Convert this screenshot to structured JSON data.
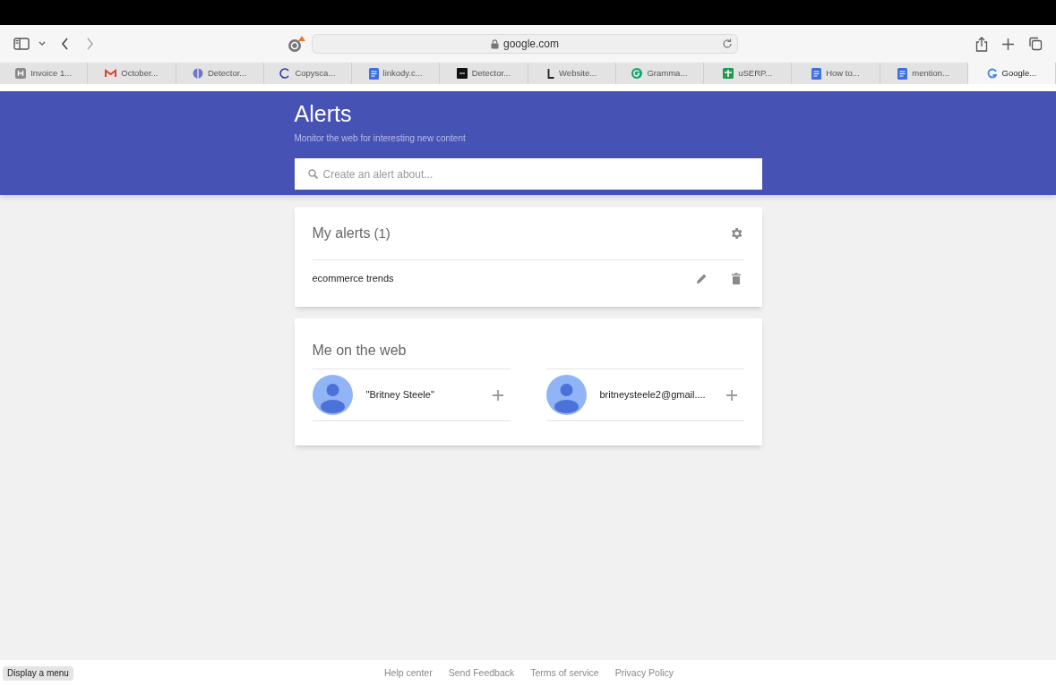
{
  "browser": {
    "address": "google.com",
    "tabs": [
      {
        "label": "Invoice 1...",
        "selected": false
      },
      {
        "label": "October...",
        "selected": false
      },
      {
        "label": "Detector...",
        "selected": false
      },
      {
        "label": "Copysca...",
        "selected": false
      },
      {
        "label": "linkody.c...",
        "selected": false
      },
      {
        "label": "Detector...",
        "selected": false
      },
      {
        "label": "Website...",
        "selected": false
      },
      {
        "label": "Gramma...",
        "selected": false
      },
      {
        "label": "uSERP...",
        "selected": false
      },
      {
        "label": "How to...",
        "selected": false
      },
      {
        "label": "mention...",
        "selected": false
      },
      {
        "label": "Google...",
        "selected": true
      }
    ]
  },
  "header": {
    "title": "Alerts",
    "subtitle": "Monitor the web for interesting new content",
    "search": {
      "placeholder": "Create an alert about..."
    }
  },
  "my_alerts": {
    "title": "My alerts",
    "count": "(1)",
    "alerts": [
      {
        "query": "ecommerce trends"
      }
    ]
  },
  "me_on_the_web": {
    "title": "Me on the web",
    "items": [
      {
        "label": "\"Britney Steele\""
      },
      {
        "label": "britneysteele2@gmail...."
      }
    ]
  },
  "footer": {
    "menu_button": "Display a menu",
    "links": [
      "Help center",
      "Send Feedback",
      "Terms of service",
      "Privacy Policy"
    ]
  }
}
